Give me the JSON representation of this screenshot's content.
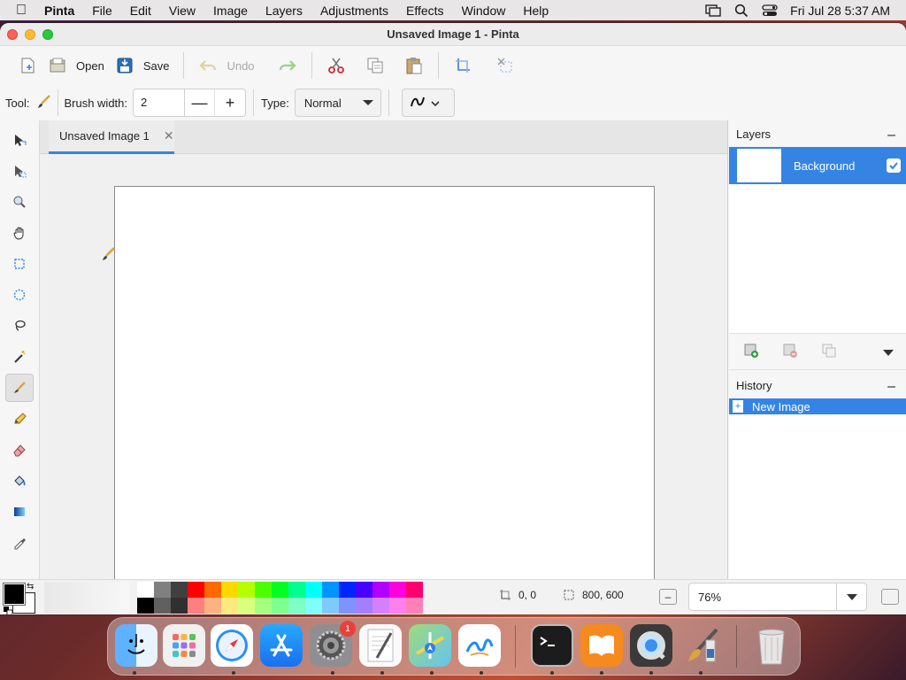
{
  "menubar": {
    "app_name": "Pinta",
    "items": [
      "File",
      "Edit",
      "View",
      "Image",
      "Layers",
      "Adjustments",
      "Effects",
      "Window",
      "Help"
    ],
    "clock": "Fri Jul 28  5:37 AM"
  },
  "window": {
    "title": "Unsaved Image 1 - Pinta"
  },
  "toolbar": {
    "open_label": "Open",
    "save_label": "Save",
    "undo_label": "Undo"
  },
  "tool_options": {
    "tool_label": "Tool:",
    "brush_width_label": "Brush width:",
    "brush_width_value": "2",
    "type_label": "Type:",
    "type_value": "Normal"
  },
  "document": {
    "tab_label": "Unsaved Image 1"
  },
  "layers_panel": {
    "title": "Layers",
    "layers": [
      {
        "name": "Background",
        "visible": true
      }
    ]
  },
  "history_panel": {
    "title": "History",
    "items": [
      "New Image"
    ]
  },
  "statusbar": {
    "cursor_position": "0, 0",
    "image_size": "800, 600",
    "zoom": "76%"
  },
  "palette": {
    "primary": "#000000",
    "secondary": "#ffffff",
    "top_row": [
      "#ffffff",
      "#808080",
      "#404040",
      "#ff0000",
      "#ff6a00",
      "#ffd800",
      "#b6ff00",
      "#4cff00",
      "#00ff21",
      "#00ff90",
      "#00ffff",
      "#0094ff",
      "#0026ff",
      "#4800ff",
      "#b200ff",
      "#ff00dc",
      "#ff006e"
    ],
    "bottom_row": [
      "#000000",
      "#606060",
      "#303030",
      "#ff7f7f",
      "#ffb27f",
      "#ffe97f",
      "#daff7f",
      "#a5ff7f",
      "#7fff8e",
      "#7fffc5",
      "#7fffff",
      "#7fc9ff",
      "#7f92ff",
      "#a17fff",
      "#d67fff",
      "#ff7fed",
      "#ff7fb6"
    ]
  },
  "dock": {
    "apps": [
      "finder-icon",
      "launchpad-icon",
      "safari-icon",
      "app-store-icon",
      "system-settings-icon",
      "textedit-icon",
      "maps-icon",
      "freeform-icon",
      "terminal-icon",
      "books-icon",
      "quicktime-icon",
      "pinta-icon",
      "trash-icon"
    ],
    "settings_badge": "1"
  },
  "colors": {
    "accent": "#3584e4"
  }
}
